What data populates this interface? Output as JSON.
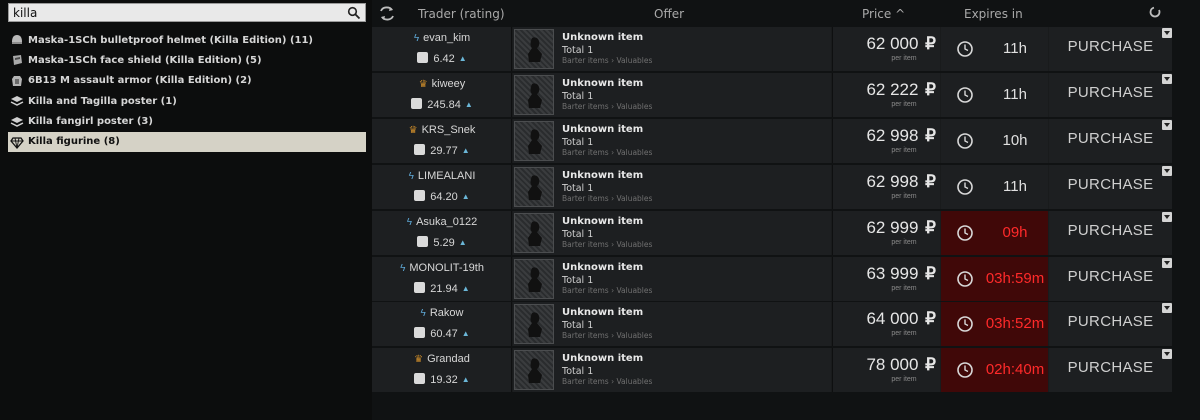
{
  "search": {
    "value": "killa",
    "icon": "search-icon"
  },
  "results": [
    {
      "label": "Maska-1SCh bulletproof helmet (Killa Edition) (11)",
      "icon": "helmet-icon",
      "selected": false
    },
    {
      "label": "Maska-1SCh face shield (Killa Edition) (5)",
      "icon": "face-shield-icon",
      "selected": false
    },
    {
      "label": "6B13 M assault armor (Killa Edition) (2)",
      "icon": "armor-icon",
      "selected": false
    },
    {
      "label": "Killa and Tagilla poster (1)",
      "icon": "stack-icon",
      "selected": false
    },
    {
      "label": "Killa fangirl poster (3)",
      "icon": "stack-icon",
      "selected": false
    },
    {
      "label": "Killa figurine (8)",
      "icon": "diamond-icon",
      "selected": true
    }
  ],
  "header": {
    "trader": "Trader (rating)",
    "offer": "Offer",
    "price": "Price ^",
    "expires": "Expires in"
  },
  "offers": [
    {
      "trader": "evan_kim",
      "badge": "bolt",
      "rating": "6.42",
      "item": "Unknown item",
      "total": "Total 1",
      "category": "Barter items › Valuables",
      "price": "62 000",
      "currency": "₽",
      "per": "per item",
      "expires": "11h",
      "urgent": false,
      "action": "PURCHASE"
    },
    {
      "trader": "kiweey",
      "badge": "crown",
      "rating": "245.84",
      "item": "Unknown item",
      "total": "Total 1",
      "category": "Barter items › Valuables",
      "price": "62 222",
      "currency": "₽",
      "per": "per item",
      "expires": "11h",
      "urgent": false,
      "action": "PURCHASE"
    },
    {
      "trader": "KRS_Snek",
      "badge": "crown",
      "rating": "29.77",
      "item": "Unknown item",
      "total": "Total 1",
      "category": "Barter items › Valuables",
      "price": "62 998",
      "currency": "₽",
      "per": "per item",
      "expires": "10h",
      "urgent": false,
      "action": "PURCHASE"
    },
    {
      "trader": "LIMEALANI",
      "badge": "bolt",
      "rating": "64.20",
      "item": "Unknown item",
      "total": "Total 1",
      "category": "Barter items › Valuables",
      "price": "62 998",
      "currency": "₽",
      "per": "per item",
      "expires": "11h",
      "urgent": false,
      "action": "PURCHASE"
    },
    {
      "trader": "Asuka_0122",
      "badge": "bolt",
      "rating": "5.29",
      "item": "Unknown item",
      "total": "Total 1",
      "category": "Barter items › Valuables",
      "price": "62 999",
      "currency": "₽",
      "per": "per item",
      "expires": "09h",
      "urgent": true,
      "action": "PURCHASE"
    },
    {
      "trader": "MONOLIT-19th",
      "badge": "bolt",
      "rating": "21.94",
      "item": "Unknown item",
      "total": "Total 1",
      "category": "Barter items › Valuables",
      "price": "63 999",
      "currency": "₽",
      "per": "per item",
      "expires": "03h:59m",
      "urgent": true,
      "action": "PURCHASE"
    },
    {
      "trader": "Rakow",
      "badge": "bolt",
      "rating": "60.47",
      "item": "Unknown item",
      "total": "Total 1",
      "category": "Barter items › Valuables",
      "price": "64 000",
      "currency": "₽",
      "per": "per item",
      "expires": "03h:52m",
      "urgent": true,
      "action": "PURCHASE"
    },
    {
      "trader": "Grandad",
      "badge": "crown",
      "rating": "19.32",
      "item": "Unknown item",
      "total": "Total 1",
      "category": "Barter items › Valuables",
      "price": "78 000",
      "currency": "₽",
      "per": "per item",
      "expires": "02h:40m",
      "urgent": true,
      "action": "PURCHASE"
    }
  ],
  "colors": {
    "accent_blue": "#5ea8d6",
    "accent_gold": "#c98a2a",
    "urgent_red": "#ff2a2a",
    "urgent_bg": "#400808"
  }
}
